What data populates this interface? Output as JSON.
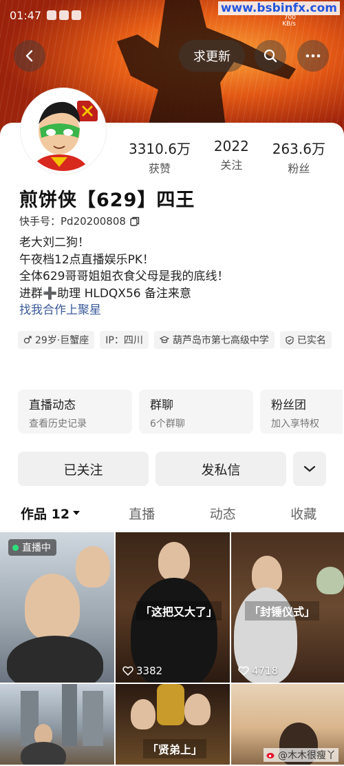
{
  "status_bar": {
    "time": "01:47",
    "net_speed_value": "700",
    "net_speed_unit": "KB/s",
    "watermark_url": "www.bsbinfx.com"
  },
  "header": {
    "update_button": "求更新"
  },
  "profile": {
    "stats": [
      {
        "value": "3310.6万",
        "label": "获赞"
      },
      {
        "value": "2022",
        "label": "关注"
      },
      {
        "value": "263.6万",
        "label": "粉丝"
      }
    ],
    "name": "煎饼侠【629】四王",
    "kuaishou_id": "快手号：Pd20200808",
    "bio_lines": [
      "老大刘二狗！",
      "午夜档12点直播娱乐PK！",
      "全体629哥哥姐姐衣食父母是我的底线！",
      "进群➕助理  HLDQX56  备注来意"
    ],
    "bio_link": "找我合作上聚星",
    "tags": [
      "29岁·巨蟹座",
      "IP：四川",
      "葫芦岛市第七高级中学",
      "已实名"
    ]
  },
  "features": [
    {
      "title": "直播动态",
      "subtitle": "查看历史记录"
    },
    {
      "title": "群聊",
      "subtitle": "6个群聊"
    },
    {
      "title": "粉丝团",
      "subtitle": "加入享特权"
    }
  ],
  "actions": {
    "follow": "已关注",
    "message": "发私信"
  },
  "tabs": [
    {
      "label": "作品 12"
    },
    {
      "label": "直播"
    },
    {
      "label": "动态"
    },
    {
      "label": "收藏"
    }
  ],
  "grid": {
    "live_badge": "直播中",
    "videos": [
      {
        "caption": "",
        "likes": ""
      },
      {
        "caption": "「这把又大了」",
        "likes": "3382"
      },
      {
        "caption": "「封锤仪式」",
        "likes": "4718"
      },
      {
        "caption": "",
        "likes": ""
      },
      {
        "caption": "「贤弟上」",
        "likes": ""
      },
      {
        "caption": "",
        "likes": ""
      }
    ],
    "weibo_watermark": "@木木很瘦丫"
  },
  "colors": {
    "accent_link": "#3a5a9a",
    "live_dot": "#2ee07c"
  }
}
